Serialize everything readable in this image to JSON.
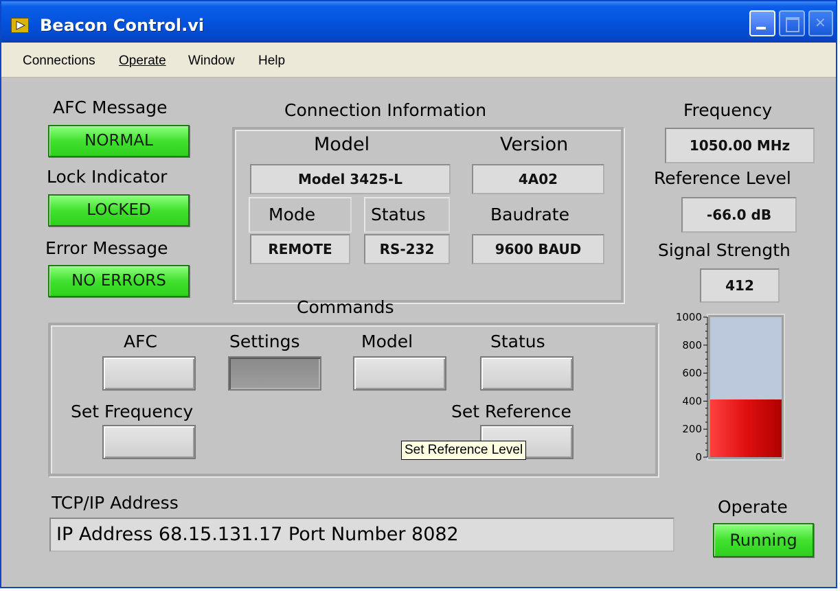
{
  "window": {
    "title": "Beacon Control.vi"
  },
  "menu": {
    "connections": "Connections",
    "operate": "Operate",
    "window": "Window",
    "help": "Help"
  },
  "left": {
    "afc_label": "AFC Message",
    "afc_value": "NORMAL",
    "lock_label": "Lock Indicator",
    "lock_value": "LOCKED",
    "error_label": "Error Message",
    "error_value": "NO ERRORS"
  },
  "connection": {
    "title": "Connection Information",
    "model_label": "Model",
    "model_value": "Model 3425-L",
    "version_label": "Version",
    "version_value": "4A02",
    "mode_label": "Mode",
    "mode_value": "REMOTE",
    "status_label": "Status",
    "status_value": "RS-232",
    "baud_label": "Baudrate",
    "baud_value": "9600 BAUD"
  },
  "commands": {
    "title": "Commands",
    "afc": "AFC",
    "settings": "Settings",
    "model": "Model",
    "status": "Status",
    "set_frequency": "Set Frequency",
    "set_reference": "Set Reference",
    "tooltip": "Set Reference Level"
  },
  "right": {
    "frequency_label": "Frequency",
    "frequency_value": "1050.00 MHz",
    "reference_label": "Reference Level",
    "reference_value": "-66.0 dB",
    "signal_label": "Signal Strength",
    "signal_value": "412"
  },
  "meter": {
    "min": 0,
    "max": 1000,
    "level": 412,
    "ticks": [
      "1000",
      "800",
      "600",
      "400",
      "200",
      "0"
    ],
    "fill_color": "#e01010",
    "empty_color": "#bcc8dc"
  },
  "tcp": {
    "label": "TCP/IP Address",
    "value": "IP Address  68.15.131.17  Port Number 8082"
  },
  "operate": {
    "label": "Operate",
    "value": "Running"
  }
}
